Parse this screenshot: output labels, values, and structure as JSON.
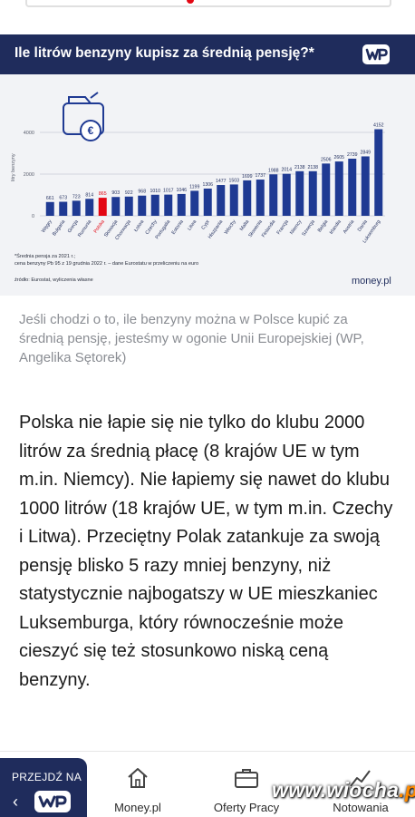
{
  "infographic": {
    "title": "Ile litrów benzyny kupisz za średnią pensję?*",
    "brand": "WP",
    "footnote_1": "*Średnia pensja za 2021 r.;",
    "footnote_2": "cena benzyny Pb 95 z 19 grudnia 2022 r. – dane Eurostatu w przeliczeniu na euro",
    "source": "źródło: Eurostat, wyliczenia własne",
    "logo_text": "money",
    "logo_suffix": ".pl",
    "colors": {
      "header": "#1f2c5c",
      "bar": "#1f3a93",
      "highlight": "#e30613",
      "background": "#f2f3f6"
    }
  },
  "chart_data": {
    "type": "bar",
    "ylabel": "litry benzyny",
    "ylim": [
      0,
      4500
    ],
    "yticks": [
      "0",
      "2000",
      "4000"
    ],
    "categories": [
      "Węgry",
      "Bułgaria",
      "Grecja",
      "Rumunia",
      "Polska",
      "Słowacja",
      "Chorwacja",
      "Łotwa",
      "Czechy",
      "Portugalia",
      "Estonia",
      "Litwa",
      "Cypr",
      "Hiszpania",
      "Włochy",
      "Malta",
      "Słowenia",
      "Finlandia",
      "Francja",
      "Niemcy",
      "Szwecja",
      "Belgia",
      "Irlandia",
      "Austria",
      "Dania",
      "Luksemburg"
    ],
    "values": [
      661,
      673,
      723,
      814,
      865,
      903,
      922,
      968,
      1010,
      1017,
      1046,
      1199,
      1306,
      1477,
      1503,
      1699,
      1737,
      1988,
      2014,
      2138,
      2138,
      2506,
      2605,
      2739,
      2849,
      4152
    ],
    "value_labels": [
      "661",
      "673",
      "723",
      "814",
      "865",
      "903",
      "922",
      "968",
      "1010",
      "1017",
      "1046",
      "1199",
      "1306",
      "1477",
      "1503",
      "1699",
      "1737",
      "1988",
      "2014",
      "2138",
      "2138",
      "2506",
      "2605",
      "2739",
      "2849",
      "4152"
    ],
    "highlight_category": "Polska",
    "grid": true
  },
  "caption": "Jeśli chodzi o to, ile benzyny można w Polsce kupić za średnią pensję, jesteśmy w ogonie Unii Europejskiej (WP, Angelika Sętorek)",
  "article": {
    "paragraph": "Polska nie łapie się nie tylko do klubu 2000 litrów za średnią płacę (8 krajów UE w tym m.in. Niemcy). Nie łapiemy się nawet do klubu 1000 litrów (18 krajów UE, w tym m.in. Czechy i Litwa). Przeciętny Polak zatankuje za swoją pensję blisko 5 razy mniej benzyny, niż statystycznie najbogatszy w UE mieszkaniec Luksemburga, który równocześnie może cieszyć się też stosunkowo niską ceną benzyny."
  },
  "bottom_nav": {
    "go_to_label": "PRZEJDŹ NA",
    "go_to_brand": "WP",
    "items": [
      {
        "label": "Money.pl",
        "icon": "home-icon"
      },
      {
        "label": "Oferty Pracy",
        "icon": "briefcase-icon"
      },
      {
        "label": "Notowania",
        "icon": "chart-line-icon"
      }
    ]
  },
  "watermark": {
    "main": "www.wiocha",
    "suffix": ".pl"
  }
}
